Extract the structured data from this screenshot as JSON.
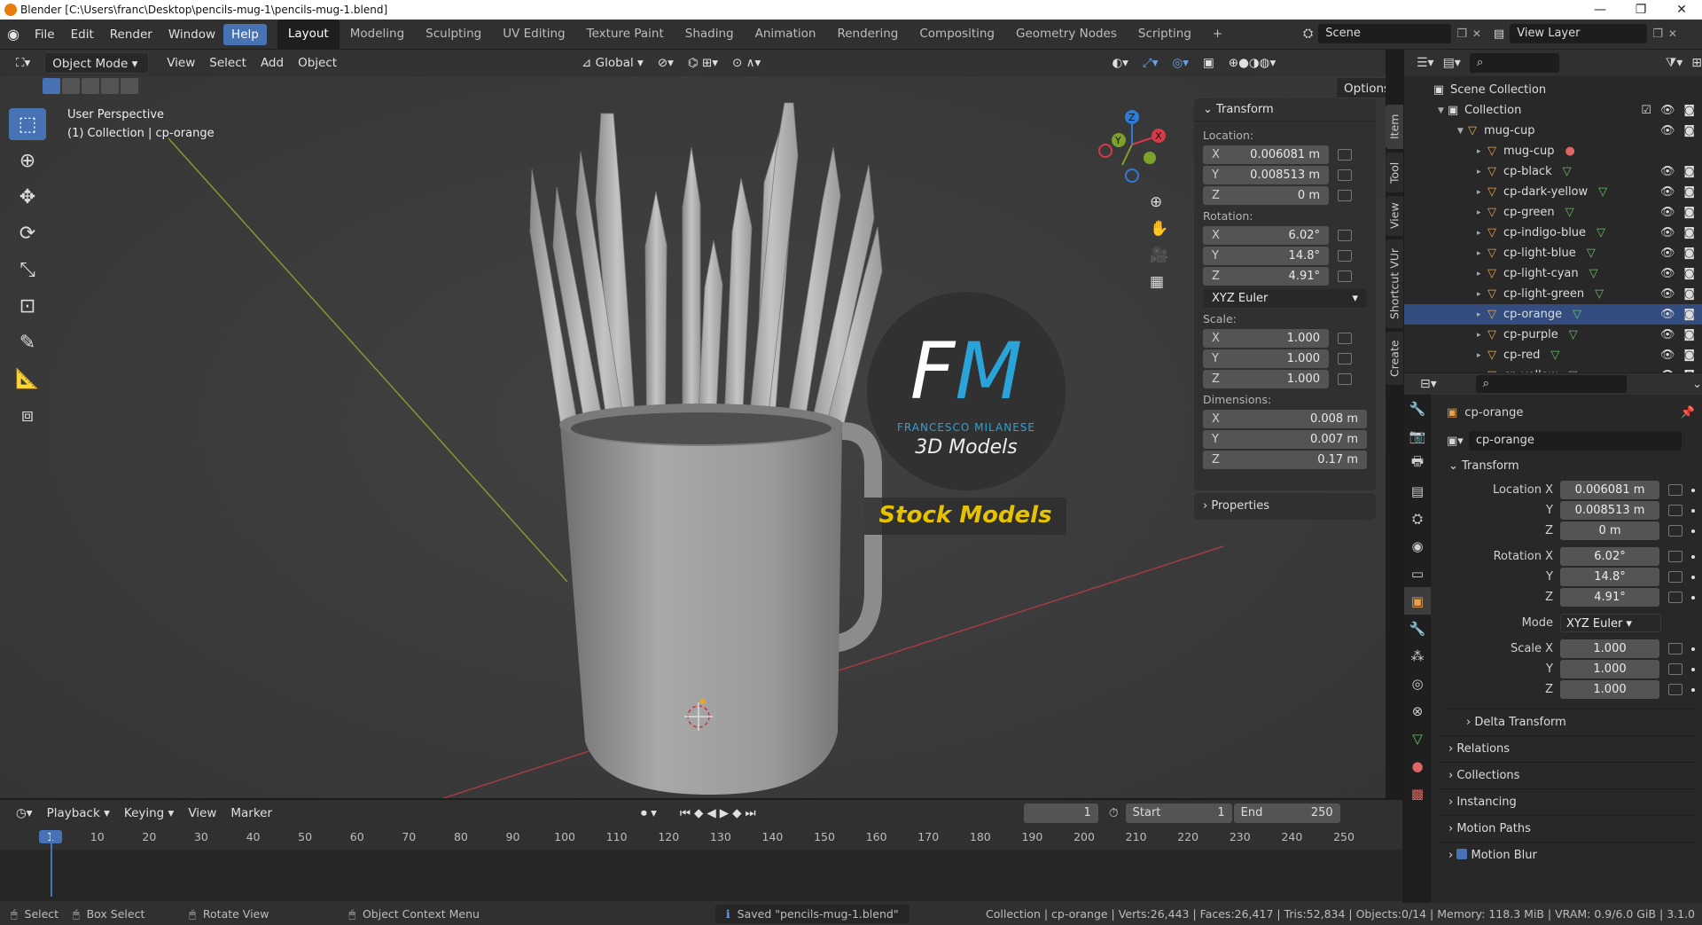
{
  "window": {
    "title": "Blender [C:\\Users\\franc\\Desktop\\pencils-mug-1\\pencils-mug-1.blend]",
    "minimize": "—",
    "maximize": "❐",
    "close": "✕"
  },
  "menus": [
    "File",
    "Edit",
    "Render",
    "Window",
    "Help"
  ],
  "workspaces": [
    "Layout",
    "Modeling",
    "Sculpting",
    "UV Editing",
    "Texture Paint",
    "Shading",
    "Animation",
    "Rendering",
    "Compositing",
    "Geometry Nodes",
    "Scripting",
    "+"
  ],
  "scene": {
    "name": "Scene",
    "view_layer": "View Layer"
  },
  "viewport": {
    "mode": "Object Mode",
    "menus": [
      "View",
      "Select",
      "Add",
      "Object"
    ],
    "orientation": "Global",
    "options": "Options",
    "overlay_title": "User Perspective",
    "overlay_sub": "(1) Collection | cp-orange",
    "gizmo": {
      "x": "X",
      "y": "Y",
      "z": "Z"
    },
    "watermark": {
      "initials_f": "F",
      "initials_m": "M",
      "name": "FRANCESCO MILANESE",
      "sub": "3D Models",
      "stock": "Stock Models"
    }
  },
  "npanel": {
    "tabs": [
      "Item",
      "Tool",
      "View",
      "Shortcut VUr",
      "Create"
    ],
    "header": "Transform",
    "location_label": "Location:",
    "location": [
      {
        "ax": "X",
        "v": "0.006081 m"
      },
      {
        "ax": "Y",
        "v": "0.008513 m"
      },
      {
        "ax": "Z",
        "v": "0 m"
      }
    ],
    "rotation_label": "Rotation:",
    "rotation": [
      {
        "ax": "X",
        "v": "6.02°"
      },
      {
        "ax": "Y",
        "v": "14.8°"
      },
      {
        "ax": "Z",
        "v": "4.91°"
      }
    ],
    "rotation_mode": "XYZ Euler",
    "scale_label": "Scale:",
    "scale": [
      {
        "ax": "X",
        "v": "1.000"
      },
      {
        "ax": "Y",
        "v": "1.000"
      },
      {
        "ax": "Z",
        "v": "1.000"
      }
    ],
    "dimensions_label": "Dimensions:",
    "dimensions": [
      {
        "ax": "X",
        "v": "0.008 m"
      },
      {
        "ax": "Y",
        "v": "0.007 m"
      },
      {
        "ax": "Z",
        "v": "0.17 m"
      }
    ],
    "properties": "Properties"
  },
  "timeline": {
    "menus": [
      "Playback",
      "Keying",
      "View",
      "Marker"
    ],
    "current_frame": "1",
    "start_label": "Start",
    "start": "1",
    "end_label": "End",
    "end": "250",
    "ticks": [
      "1",
      "10",
      "20",
      "30",
      "40",
      "50",
      "60",
      "70",
      "80",
      "90",
      "100",
      "110",
      "120",
      "130",
      "140",
      "150",
      "160",
      "170",
      "180",
      "190",
      "200",
      "210",
      "220",
      "230",
      "240",
      "250"
    ]
  },
  "status": {
    "select": "Select",
    "box_select": "Box Select",
    "rotate": "Rotate View",
    "context": "Object Context Menu",
    "message": "Saved \"pencils-mug-1.blend\"",
    "stats": "Collection | cp-orange | Verts:26,443 | Faces:26,417 | Tris:52,834 | Objects:0/14 | Memory: 118.3 MiB | VRAM: 0.9/6.0 GiB | 3.1.0"
  },
  "outliner": {
    "root": "Scene Collection",
    "collection": "Collection",
    "group": "mug-cup",
    "items": [
      "mug-cup",
      "cp-black",
      "cp-dark-yellow",
      "cp-green",
      "cp-indigo-blue",
      "cp-light-blue",
      "cp-light-cyan",
      "cp-light-green",
      "cp-orange",
      "cp-purple",
      "cp-red",
      "cp-yellow"
    ],
    "selected": "cp-orange"
  },
  "properties": {
    "object_name": "cp-orange",
    "data_name": "cp-orange",
    "transform": "Transform",
    "location_x_label": "Location X",
    "y_label": "Y",
    "z_label": "Z",
    "rotation_x_label": "Rotation X",
    "mode_label": "Mode",
    "scale_x_label": "Scale X",
    "location": [
      "0.006081 m",
      "0.008513 m",
      "0 m"
    ],
    "rotation": [
      "6.02°",
      "14.8°",
      "4.91°"
    ],
    "mode": "XYZ Euler",
    "scale": [
      "1.000",
      "1.000",
      "1.000"
    ],
    "sections": [
      "Delta Transform",
      "Relations",
      "Collections",
      "Instancing",
      "Motion Paths",
      "Motion Blur"
    ]
  }
}
